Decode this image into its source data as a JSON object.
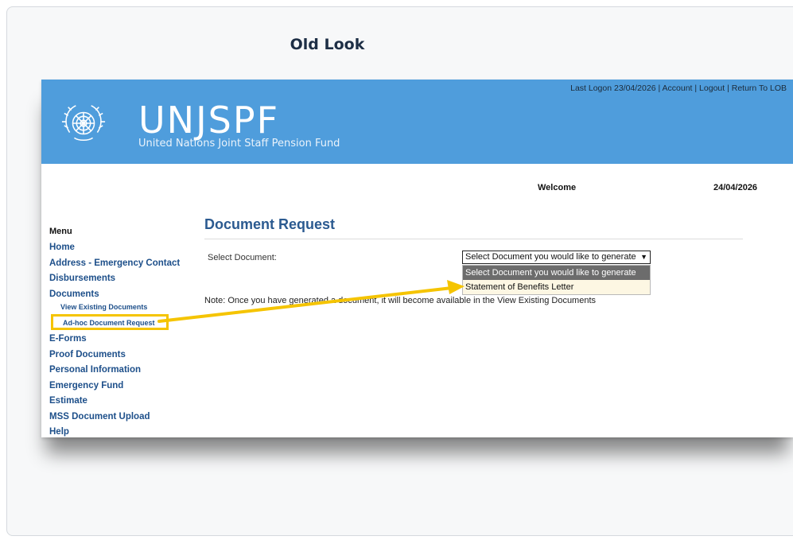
{
  "card": {
    "title": "Old Look"
  },
  "banner": {
    "logo_text": "UNJSPF",
    "logo_subtitle": "United Nations Joint Staff Pension Fund",
    "last_logon": "Last Logon 23/04/2026",
    "links": [
      "Account",
      "Logout",
      "Return To LOB"
    ],
    "color": "#4f9ddc"
  },
  "header": {
    "welcome": "Welcome",
    "date": "24/04/2026"
  },
  "menu": {
    "heading": "Menu",
    "items": [
      "Home",
      "Address - Emergency Contact",
      "Disbursements",
      "Documents",
      "View Existing Documents",
      "Ad-hoc Document Request",
      "E-Forms",
      "Proof Documents",
      "Personal Information",
      "Emergency Fund",
      "Estimate",
      "MSS Document Upload",
      "Help"
    ]
  },
  "main": {
    "title": "Document Request",
    "select_label": "Select Document:",
    "select_value": "Select Document you would like to generate",
    "options": [
      "Select Document you would like to generate",
      "Statement of Benefits Letter"
    ],
    "note": "Note: Once you have generated a document, it will become available in the View Existing Documents"
  },
  "annotation": {
    "highlight_color": "#f5c400"
  }
}
